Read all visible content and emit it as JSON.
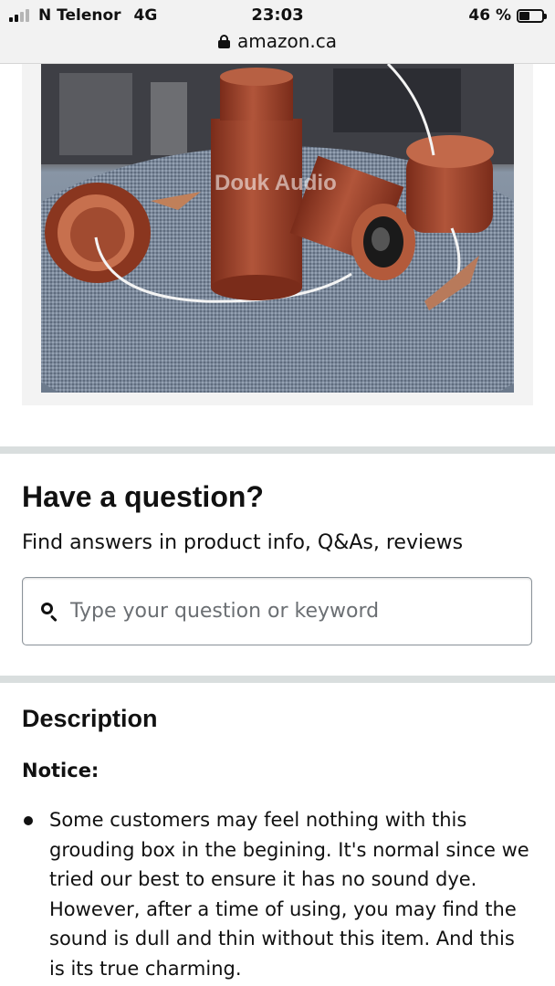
{
  "status_bar": {
    "carrier": "N Telenor",
    "network": "4G",
    "time": "23:03",
    "battery": "46 %",
    "battery_level": 0.46,
    "url": "amazon.ca",
    "icons": [
      "signal-icon",
      "lock-icon",
      "battery-icon"
    ]
  },
  "product_image": {
    "watermark": "Douk Audio"
  },
  "question_section": {
    "title": "Have a question?",
    "subtitle": "Find answers in product info, Q&As, reviews",
    "search_placeholder": "Type your question or keyword",
    "search_value": ""
  },
  "description": {
    "title": "Description",
    "notice_label": "Notice:",
    "bullets": [
      "Some customers may feel nothing with this grouding box in the begining. It's normal since we tried our best to ensure it has no sound dye. However, after a time of using, you may find the sound is dull and thin without this item. And this is its true charming."
    ]
  },
  "colors": {
    "divider": "#d9dede",
    "status_bar_bg": "#f2f2f2",
    "wood": "#a0432a"
  }
}
